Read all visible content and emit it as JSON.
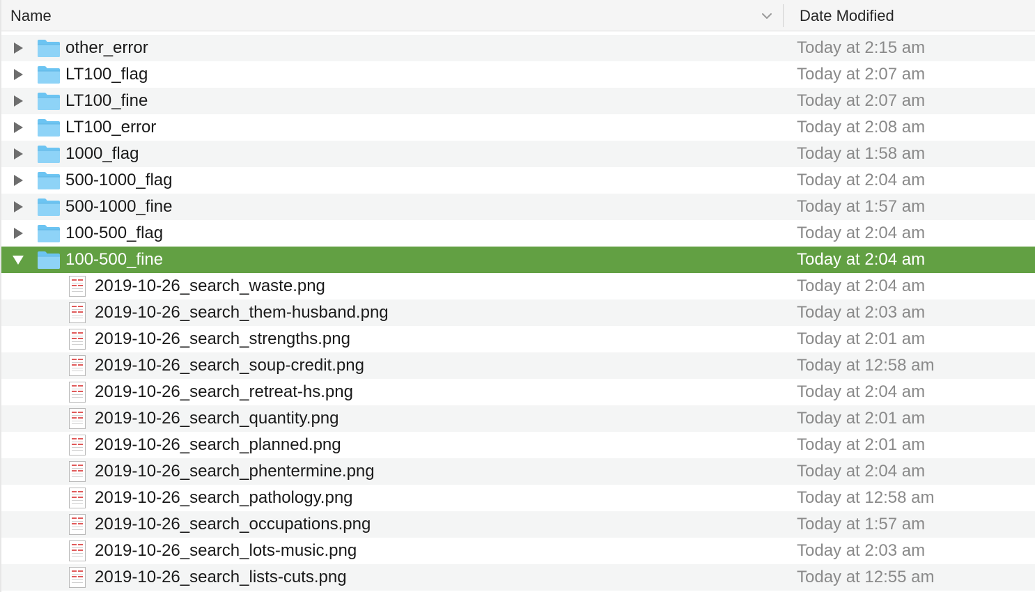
{
  "columns": {
    "name_label": "Name",
    "date_label": "Date Modified",
    "sort_icon": "chevron-down-icon"
  },
  "colors": {
    "selection": "#62a043",
    "folder": "#6cc4f2",
    "date_text": "#8a8a8a"
  },
  "rows": [
    {
      "type": "folder",
      "name": "other_error",
      "date": "Today at 2:15 am",
      "expanded": false,
      "selected": false
    },
    {
      "type": "folder",
      "name": "LT100_flag",
      "date": "Today at 2:07 am",
      "expanded": false,
      "selected": false
    },
    {
      "type": "folder",
      "name": "LT100_fine",
      "date": "Today at 2:07 am",
      "expanded": false,
      "selected": false
    },
    {
      "type": "folder",
      "name": "LT100_error",
      "date": "Today at 2:08 am",
      "expanded": false,
      "selected": false
    },
    {
      "type": "folder",
      "name": "1000_flag",
      "date": "Today at 1:58 am",
      "expanded": false,
      "selected": false
    },
    {
      "type": "folder",
      "name": "500-1000_flag",
      "date": "Today at 2:04 am",
      "expanded": false,
      "selected": false
    },
    {
      "type": "folder",
      "name": "500-1000_fine",
      "date": "Today at 1:57 am",
      "expanded": false,
      "selected": false
    },
    {
      "type": "folder",
      "name": "100-500_flag",
      "date": "Today at 2:04 am",
      "expanded": false,
      "selected": false
    },
    {
      "type": "folder",
      "name": "100-500_fine",
      "date": "Today at 2:04 am",
      "expanded": true,
      "selected": true
    },
    {
      "type": "file",
      "name": "2019-10-26_search_waste.png",
      "date": "Today at 2:04 am"
    },
    {
      "type": "file",
      "name": "2019-10-26_search_them-husband.png",
      "date": "Today at 2:03 am"
    },
    {
      "type": "file",
      "name": "2019-10-26_search_strengths.png",
      "date": "Today at 2:01 am"
    },
    {
      "type": "file",
      "name": "2019-10-26_search_soup-credit.png",
      "date": "Today at 12:58 am"
    },
    {
      "type": "file",
      "name": "2019-10-26_search_retreat-hs.png",
      "date": "Today at 2:04 am"
    },
    {
      "type": "file",
      "name": "2019-10-26_search_quantity.png",
      "date": "Today at 2:01 am"
    },
    {
      "type": "file",
      "name": "2019-10-26_search_planned.png",
      "date": "Today at 2:01 am"
    },
    {
      "type": "file",
      "name": "2019-10-26_search_phentermine.png",
      "date": "Today at 2:04 am"
    },
    {
      "type": "file",
      "name": "2019-10-26_search_pathology.png",
      "date": "Today at 12:58 am"
    },
    {
      "type": "file",
      "name": "2019-10-26_search_occupations.png",
      "date": "Today at 1:57 am"
    },
    {
      "type": "file",
      "name": "2019-10-26_search_lots-music.png",
      "date": "Today at 2:03 am"
    },
    {
      "type": "file",
      "name": "2019-10-26_search_lists-cuts.png",
      "date": "Today at 12:55 am"
    }
  ]
}
